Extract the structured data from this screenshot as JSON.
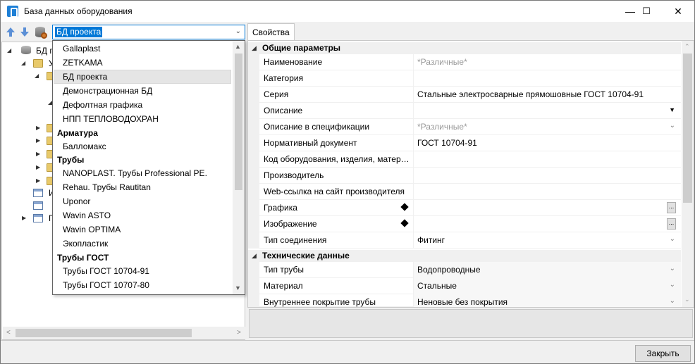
{
  "window": {
    "title": "База данных оборудования",
    "minimize_glyph": "—",
    "maximize_glyph": "☐",
    "close_glyph": "✕"
  },
  "toolbar": {
    "combo_value": "БД проекта",
    "combo_arrow": "⌄"
  },
  "tree": {
    "visible_items": [
      {
        "label": "БД п",
        "level": 0,
        "icon": "database-icon",
        "expanded": true
      },
      {
        "label": "У",
        "level": 1,
        "icon": "folder-icon",
        "expanded": true
      },
      {
        "label": "И",
        "level": 1,
        "icon": "table-icon",
        "expanded": false
      },
      {
        "label": "Г",
        "level": 1,
        "icon": "table-icon",
        "expanded": false
      }
    ]
  },
  "dropdown": {
    "items": [
      {
        "label": "Gallaplast",
        "type": "item"
      },
      {
        "label": "ZETKAMA",
        "type": "item"
      },
      {
        "label": "БД проекта",
        "type": "item",
        "selected": true
      },
      {
        "label": "Демонстрационная БД",
        "type": "item"
      },
      {
        "label": "Дефолтная графика",
        "type": "item"
      },
      {
        "label": "НПП ТЕПЛОВОДОХРАН",
        "type": "item"
      },
      {
        "label": "Арматура",
        "type": "group"
      },
      {
        "label": "Балломакс",
        "type": "item"
      },
      {
        "label": "Трубы",
        "type": "group"
      },
      {
        "label": "NANOPLAST. Трубы Professional PE.",
        "type": "item"
      },
      {
        "label": "Rehau. Трубы Rautitan",
        "type": "item"
      },
      {
        "label": "Uponor",
        "type": "item"
      },
      {
        "label": "Wavin ASTO",
        "type": "item"
      },
      {
        "label": "Wavin OPTIMA",
        "type": "item"
      },
      {
        "label": "Экопластик",
        "type": "item"
      },
      {
        "label": "Трубы ГОСТ",
        "type": "group"
      },
      {
        "label": "Трубы ГОСТ 10704-91",
        "type": "item"
      },
      {
        "label": "Трубы ГОСТ 10707-80",
        "type": "item"
      }
    ]
  },
  "properties": {
    "tab_label": "Свойства",
    "rows": [
      {
        "kind": "category",
        "name": "Общие параметры"
      },
      {
        "kind": "prop",
        "name": "Наименование",
        "value": "*Различные*",
        "gray": true
      },
      {
        "kind": "prop",
        "name": "Категория",
        "value": ""
      },
      {
        "kind": "prop",
        "name": "Серия",
        "value": "Стальные электросварные прямошовные ГОСТ 10704-91"
      },
      {
        "kind": "prop",
        "name": "Описание",
        "value": "",
        "editor": "dropdown-dark"
      },
      {
        "kind": "prop",
        "name": "Описание в спецификации",
        "value": "*Различные*",
        "gray": true,
        "editor": "dropdown"
      },
      {
        "kind": "prop",
        "name": "Нормативный документ",
        "value": "ГОСТ 10704-91"
      },
      {
        "kind": "prop",
        "name": "Код оборудования, изделия, материала",
        "value": ""
      },
      {
        "kind": "prop",
        "name": "Производитель",
        "value": ""
      },
      {
        "kind": "prop",
        "name": "Web-ссылка на сайт производителя",
        "value": ""
      },
      {
        "kind": "prop",
        "name": "Графика",
        "value": "",
        "marker": true,
        "editor": "ellipsis"
      },
      {
        "kind": "prop",
        "name": "Изображение",
        "value": "",
        "marker": true,
        "editor": "ellipsis"
      },
      {
        "kind": "prop",
        "name": "Тип соединения",
        "value": "Фитинг",
        "editor": "dropdown"
      },
      {
        "kind": "category",
        "name": "Технические данные"
      },
      {
        "kind": "prop",
        "name": "Тип трубы",
        "value": "Водопроводные",
        "editor": "dropdown"
      },
      {
        "kind": "prop",
        "name": "Материал",
        "value": "Стальные",
        "editor": "dropdown"
      },
      {
        "kind": "prop",
        "name": "Внутреннее покрытие трубы",
        "value": "Неновые без покрытия",
        "editor": "dropdown"
      }
    ]
  },
  "footer": {
    "close_label": "Закрыть"
  },
  "colors": {
    "accent": "#0078d7",
    "gray_text": "#999999"
  }
}
